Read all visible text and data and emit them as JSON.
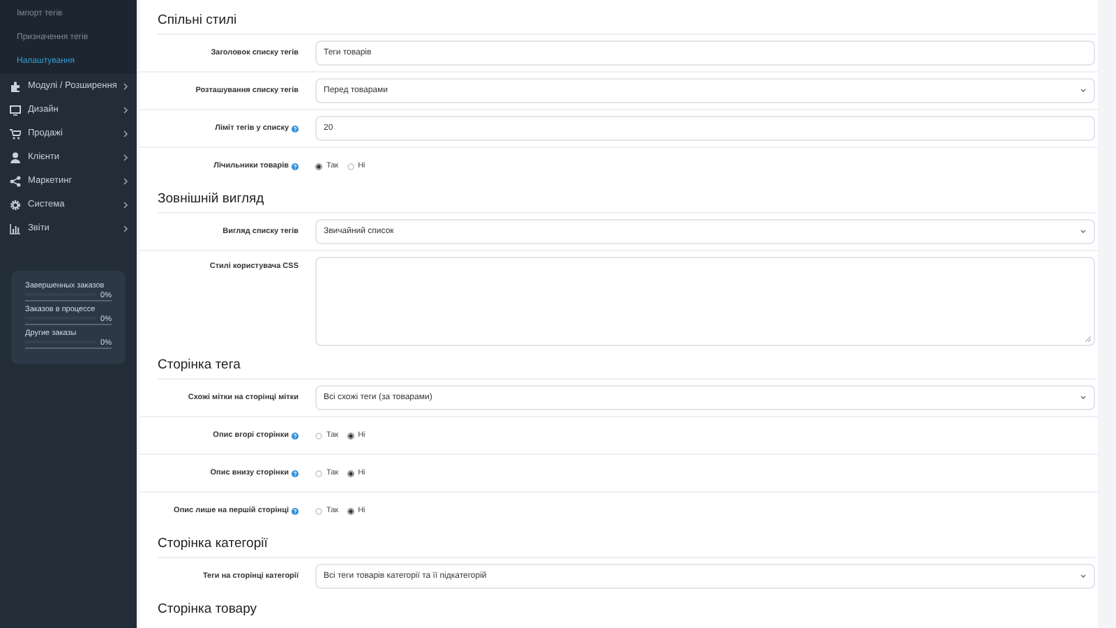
{
  "sidebar": {
    "submenu": [
      {
        "label": "Імпорт тегів",
        "selected": false
      },
      {
        "label": "Призначення тегів",
        "selected": false
      },
      {
        "label": "Налаштування",
        "selected": true
      }
    ],
    "menu": [
      {
        "label": "Модулі / Розширення"
      },
      {
        "label": "Дизайн"
      },
      {
        "label": "Продажі"
      },
      {
        "label": "Клієнти"
      },
      {
        "label": "Маркетинг"
      },
      {
        "label": "Система"
      },
      {
        "label": "Звіти"
      }
    ],
    "stats": [
      {
        "label": "Завершенных заказов",
        "value": "0%"
      },
      {
        "label": "Заказов в процессе",
        "value": "0%"
      },
      {
        "label": "Другие заказы",
        "value": "0%"
      }
    ]
  },
  "sections": [
    {
      "title": "Спільні стилі",
      "fields": [
        {
          "kind": "text",
          "label": "Заголовок списку тегів",
          "help": false,
          "value": "Теги товарів"
        },
        {
          "kind": "select",
          "label": "Розташування списку тегів",
          "help": false,
          "value": "Перед товарами"
        },
        {
          "kind": "text",
          "label": "Ліміт тегів у списку",
          "help": true,
          "value": "20"
        },
        {
          "kind": "radio",
          "label": "Лічильники товарів",
          "help": true,
          "options": [
            {
              "label": "Так",
              "selected": true
            },
            {
              "label": "Ні",
              "selected": false
            }
          ]
        }
      ]
    },
    {
      "title": "Зовнішній вигляд",
      "fields": [
        {
          "kind": "select",
          "label": "Вигляд списку тегів",
          "help": false,
          "value": "Звичайний список"
        },
        {
          "kind": "textarea",
          "label": "Стилі користувача CSS",
          "help": false
        }
      ]
    },
    {
      "title": "Сторінка тега",
      "fields": [
        {
          "kind": "select",
          "label": "Схожі мітки на сторінці мітки",
          "help": false,
          "value": "Всі схожі теги (за товарами)"
        },
        {
          "kind": "radio",
          "label": "Опис вгорі сторінки",
          "help": true,
          "options": [
            {
              "label": "Так",
              "selected": false
            },
            {
              "label": "Ні",
              "selected": true
            }
          ]
        },
        {
          "kind": "radio",
          "label": "Опис внизу сторінки",
          "help": true,
          "options": [
            {
              "label": "Так",
              "selected": false
            },
            {
              "label": "Ні",
              "selected": true
            }
          ]
        },
        {
          "kind": "radio",
          "label": "Опис лише на першій сторінці",
          "help": true,
          "options": [
            {
              "label": "Так",
              "selected": false
            },
            {
              "label": "Ні",
              "selected": true
            }
          ]
        }
      ]
    },
    {
      "title": "Сторінка категорії",
      "fields": [
        {
          "kind": "select",
          "label": "Теги на сторінці категорії",
          "help": false,
          "value": "Всі теги товарів категорії та її підкатегорій"
        }
      ]
    },
    {
      "title": "Сторінка товару"
    }
  ]
}
